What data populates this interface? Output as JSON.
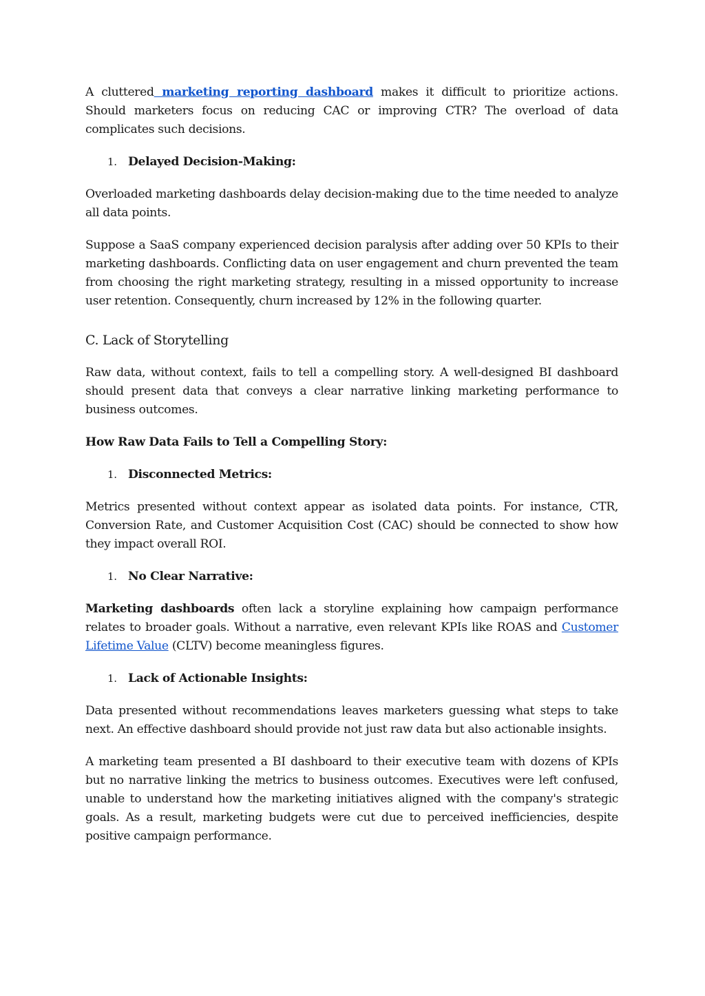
{
  "intro": {
    "pre": "A cluttered",
    "link": " marketing reporting dashboard",
    "post": " makes it difficult to prioritize actions. Should marketers focus on reducing CAC or improving CTR? The overload of data complicates such decisions."
  },
  "item_delayed": {
    "num": "1.",
    "label": "Delayed Decision-Making:"
  },
  "para_overloaded": "Overloaded marketing dashboards delay decision-making due to the time needed to analyze all data points.",
  "para_saas": "Suppose a SaaS company experienced decision paralysis after adding over 50 KPIs to their marketing dashboards. Conflicting data on user engagement and churn prevented the team from choosing the right marketing strategy, resulting in a missed opportunity to increase user retention. Consequently, churn increased by 12% in the following quarter.",
  "heading_storytelling": "C. Lack of Storytelling",
  "para_raw": "Raw data, without context, fails to tell a compelling story. A well-designed BI dashboard should present data that conveys a clear narrative linking marketing performance to business outcomes.",
  "heading_how": "How Raw Data Fails to Tell a Compelling Story:",
  "item_disconnected": {
    "num": "1.",
    "label": "Disconnected Metrics:"
  },
  "para_metrics": "Metrics presented without context appear as isolated data points. For instance, CTR, Conversion Rate, and Customer Acquisition Cost (CAC) should be connected to show how they impact overall ROI.",
  "item_narrative": {
    "num": "1.",
    "label": "No Clear Narrative:"
  },
  "para_narrative": {
    "bold": "Marketing dashboards",
    "text1": " often lack a storyline explaining how campaign performance relates to broader goals. Without a narrative, even relevant KPIs like ROAS and ",
    "link": "Customer Lifetime Value",
    "text2": " (CLTV) become meaningless figures."
  },
  "item_actionable": {
    "num": "1.",
    "label": "Lack of Actionable Insights:"
  },
  "para_actionable": "Data presented without recommendations leaves marketers guessing what steps to take next. An effective dashboard should provide not just raw data but also actionable insights.",
  "para_team": "A marketing team presented a BI dashboard to their executive team with dozens of KPIs but no narrative linking the metrics to business outcomes. Executives were left confused, unable to understand how the marketing initiatives aligned with the company's strategic goals. As a result, marketing budgets were cut due to perceived inefficiencies, despite positive campaign performance.",
  "colors": {
    "link": "#1155cc",
    "text": "#1a1a1a"
  }
}
